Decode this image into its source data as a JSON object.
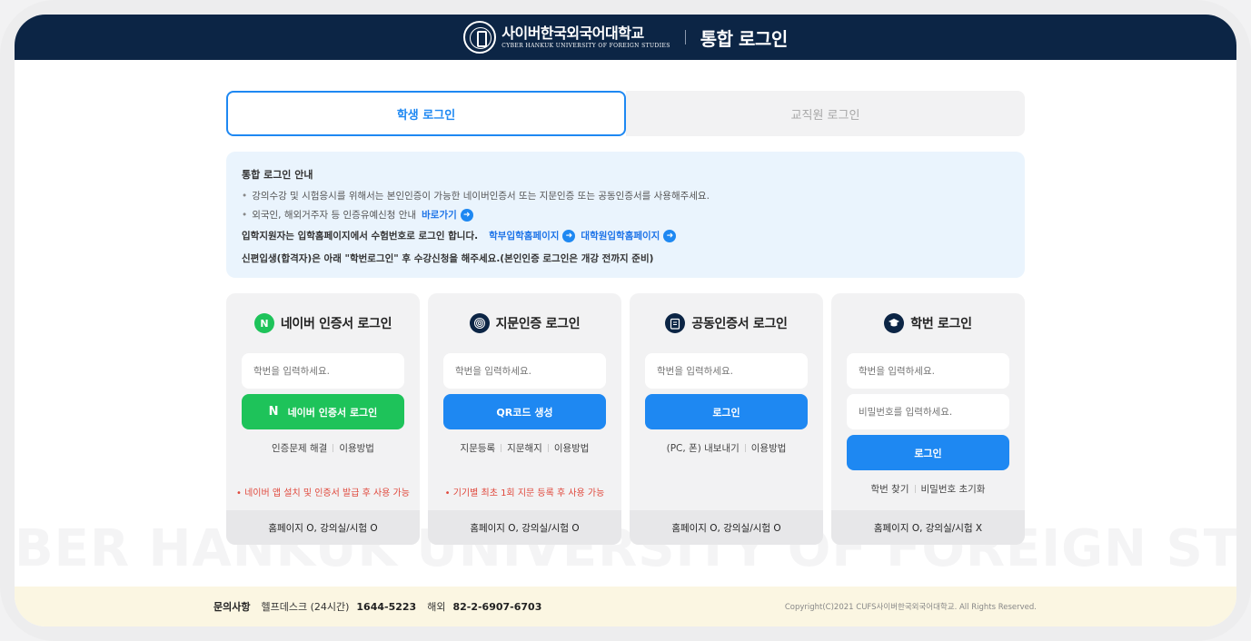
{
  "header": {
    "school_ko": "사이버한국외국어대학교",
    "school_en": "CYBER HANKUK UNIVERSITY OF FOREIGN STUDIES",
    "title": "통합 로그인"
  },
  "tabs": {
    "student": "학생 로그인",
    "staff": "교직원 로그인"
  },
  "notice": {
    "title": "통합 로그인 안내",
    "bullet1": "강의수강 및 시험응시를 위해서는 본인인증이 가능한 네이버인증서 또는 지문인증 또는 공동인증서를 사용해주세요.",
    "bullet2": "외국인, 해외거주자 등 인증유예신청 안내",
    "bullet2_link": "바로가기",
    "line3": "입학지원자는 입학홈페이지에서 수험번호로 로그인 합니다.",
    "link_undergrad": "학부입학홈페이지",
    "link_grad": "대학원입학홈페이지",
    "line4": "신편입생(합격자)은 아래 \"학번로그인\" 후 수강신청을 해주세요.(본인인증 로그인은 개강 전까지 준비)"
  },
  "cards": {
    "naver": {
      "title": "네이버 인증서 로그인",
      "placeholder": "학번을 입력하세요.",
      "button": "네이버 인증서 로그인",
      "link1": "인증문제 해결",
      "link2": "이용방법",
      "warn": "• 네이버 앱 설치 및 인증서 발급 후 사용 가능",
      "foot": "홈페이지 O, 강의실/시험 O"
    },
    "finger": {
      "title": "지문인증 로그인",
      "placeholder": "학번을 입력하세요.",
      "button": "QR코드 생성",
      "link1": "지문등록",
      "link2": "지문해지",
      "link3": "이용방법",
      "warn": "• 기기별 최초 1회 지문 등록 후 사용 가능",
      "foot": "홈페이지 O, 강의실/시험 O"
    },
    "cert": {
      "title": "공동인증서 로그인",
      "placeholder": "학번을 입력하세요.",
      "button": "로그인",
      "link1": "(PC, 폰) 내보내기",
      "link2": "이용방법",
      "foot": "홈페이지 O, 강의실/시험 O"
    },
    "id": {
      "title": "학번 로그인",
      "placeholder": "학번을 입력하세요.",
      "placeholder_pw": "비밀번호를 입력하세요.",
      "button": "로그인",
      "link1": "학번 찾기",
      "link2": "비밀번호 초기화",
      "foot": "홈페이지 O, 강의실/시험 X"
    }
  },
  "watermark": "BER HANKUK UNIVERSITY OF FOREIGN STUDI",
  "footer": {
    "label": "문의사항",
    "helpdesk": "헬프데스크 (24시간)",
    "helpdesk_num": "1644-5223",
    "overseas": "해외",
    "overseas_num": "82-2-6907-6703",
    "copyright": "Copyright(C)2021 CUFS사이버한국외국어대학교. All Rights Reserved."
  },
  "colors": {
    "navy": "#0c2545",
    "blue": "#1e88f2",
    "naver_green": "#1ec35a",
    "warn_red": "#e0493d"
  },
  "icons": {
    "naver": "naver-n-icon",
    "finger": "fingerprint-icon",
    "cert": "certificate-icon",
    "id": "graduation-cap-icon",
    "link_arrow": "arrow-right-circle-icon"
  }
}
